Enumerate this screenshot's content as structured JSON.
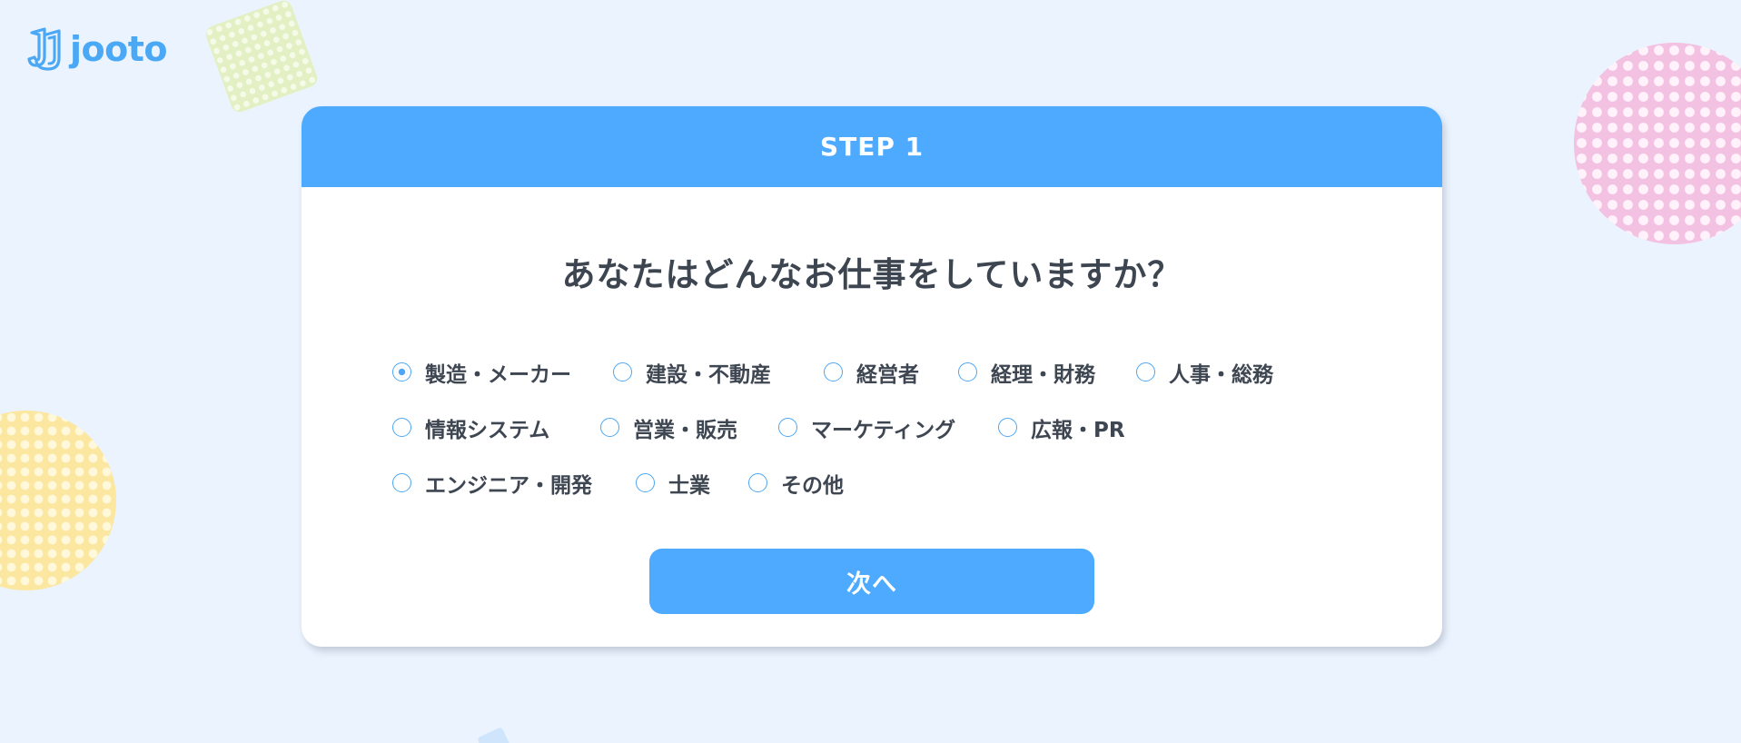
{
  "brand": {
    "logo_text": "jooto",
    "logo_icon": "jooto-logo-icon",
    "accent_color": "#4daaff"
  },
  "step": {
    "label": "STEP 1"
  },
  "question": {
    "title": "あなたはどんなお仕事をしていますか？"
  },
  "occupation_options": {
    "selected": "製造・メーカー",
    "rows": [
      [
        "製造・メーカー",
        "建設・不動産",
        "経営者",
        "経理・財務",
        "人事・総務"
      ],
      [
        "情報システム",
        "営業・販売",
        "マーケティング",
        "広報・PR"
      ],
      [
        "エンジニア・開発",
        "士業",
        "その他"
      ]
    ]
  },
  "actions": {
    "next_label": "次へ"
  }
}
